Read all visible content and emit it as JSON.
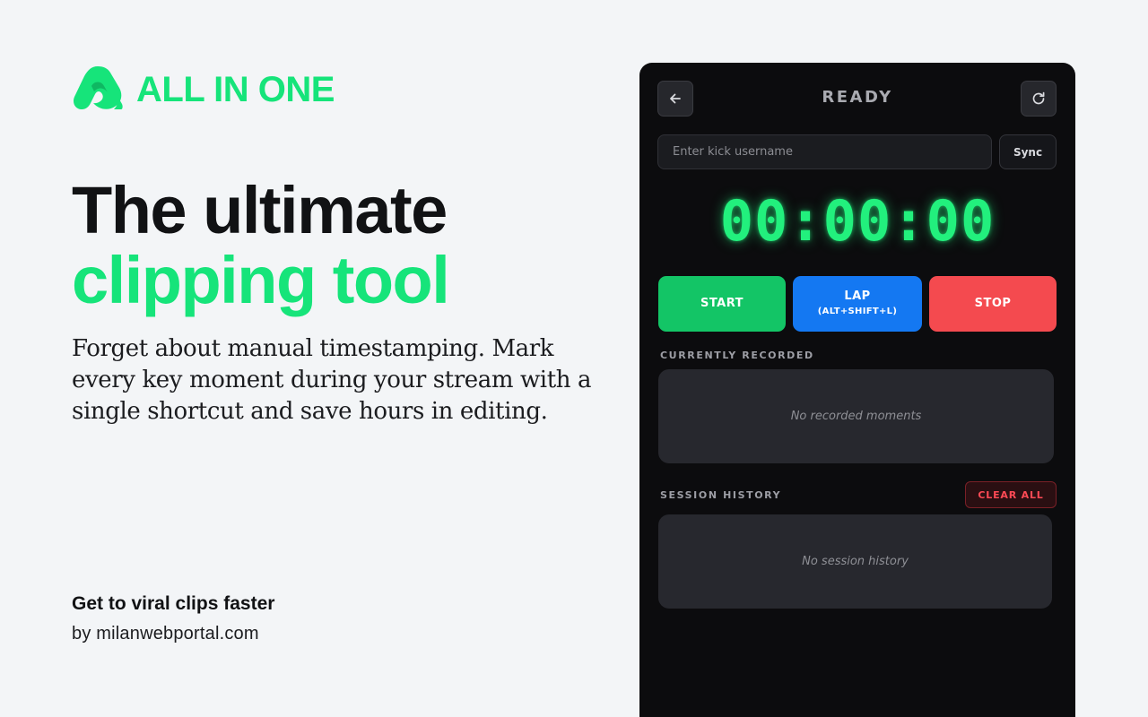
{
  "brand": {
    "name": "ALL IN ONE",
    "logo_icon": "all-in-one-logo-icon",
    "color": "#16e47a"
  },
  "hero": {
    "headline_line1": "The ultimate",
    "headline_line2": "clipping tool",
    "description": "Forget about manual timestamping. Mark every key moment during your stream with a single shortcut and save hours in editing."
  },
  "footer": {
    "tagline": "Get to viral clips faster",
    "byline": "by milanwebportal.com"
  },
  "panel": {
    "back_icon": "arrow-left-icon",
    "status": "READY",
    "refresh_icon": "refresh-icon",
    "username_placeholder": "Enter kick username",
    "username_value": "",
    "sync_label": "Sync",
    "timer": "00:00:00",
    "buttons": {
      "start": {
        "label": "START",
        "color": "#13c566"
      },
      "lap": {
        "label": "LAP",
        "shortcut": "(ALT+SHIFT+L)",
        "color": "#1478f2"
      },
      "stop": {
        "label": "STOP",
        "color": "#f44a4f"
      }
    },
    "recorded": {
      "title": "CURRENTLY RECORDED",
      "empty_text": "No recorded moments"
    },
    "history": {
      "title": "SESSION HISTORY",
      "clear_label": "CLEAR ALL",
      "empty_text": "No session history"
    },
    "timer_color": "#22f07d"
  }
}
